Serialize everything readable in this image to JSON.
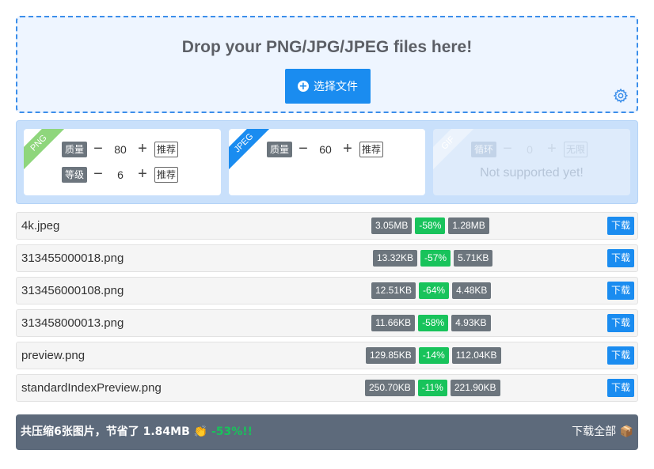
{
  "dropzone": {
    "title": "Drop your PNG/JPG/JPEG files here!",
    "choose_label": "选择文件",
    "icons": {
      "choose": "plus-circle-icon",
      "settings": "gear-icon"
    }
  },
  "settings": {
    "png": {
      "ribbon": "PNG",
      "quality_label": "质量",
      "quality_value": "80",
      "level_label": "等级",
      "level_value": "6",
      "recommend": "推荐"
    },
    "jpeg": {
      "ribbon": "JPEG",
      "quality_label": "质量",
      "quality_value": "60",
      "recommend": "推荐"
    },
    "gif": {
      "ribbon": "GIF",
      "loop_label": "循环",
      "loop_value": "0",
      "infinite": "无限",
      "unsupported": "Not supported yet!"
    }
  },
  "files": [
    {
      "name": "4k.jpeg",
      "original": "3.05MB",
      "ratio": "-58%",
      "compressed": "1.28MB",
      "download": "下载"
    },
    {
      "name": "313455000018.png",
      "original": "13.32KB",
      "ratio": "-57%",
      "compressed": "5.71KB",
      "download": "下载"
    },
    {
      "name": "313456000108.png",
      "original": "12.51KB",
      "ratio": "-64%",
      "compressed": "4.48KB",
      "download": "下载"
    },
    {
      "name": "313458000013.png",
      "original": "11.66KB",
      "ratio": "-58%",
      "compressed": "4.93KB",
      "download": "下载"
    },
    {
      "name": "preview.png",
      "original": "129.85KB",
      "ratio": "-14%",
      "compressed": "112.04KB",
      "download": "下载"
    },
    {
      "name": "standardIndexPreview.png",
      "original": "250.70KB",
      "ratio": "-11%",
      "compressed": "221.90KB",
      "download": "下载"
    }
  ],
  "summary": {
    "prefix": "共压缩6张图片，节省了",
    "saved": "1.84MB",
    "emoji": "👏",
    "percent": "-53%!!",
    "download_all": "下载全部",
    "download_all_icon": "📦"
  },
  "colors": {
    "accent": "#1a8cf0",
    "positive": "#18c35b",
    "badge": "#6c757d",
    "summary_bg": "#5d6a7b"
  }
}
